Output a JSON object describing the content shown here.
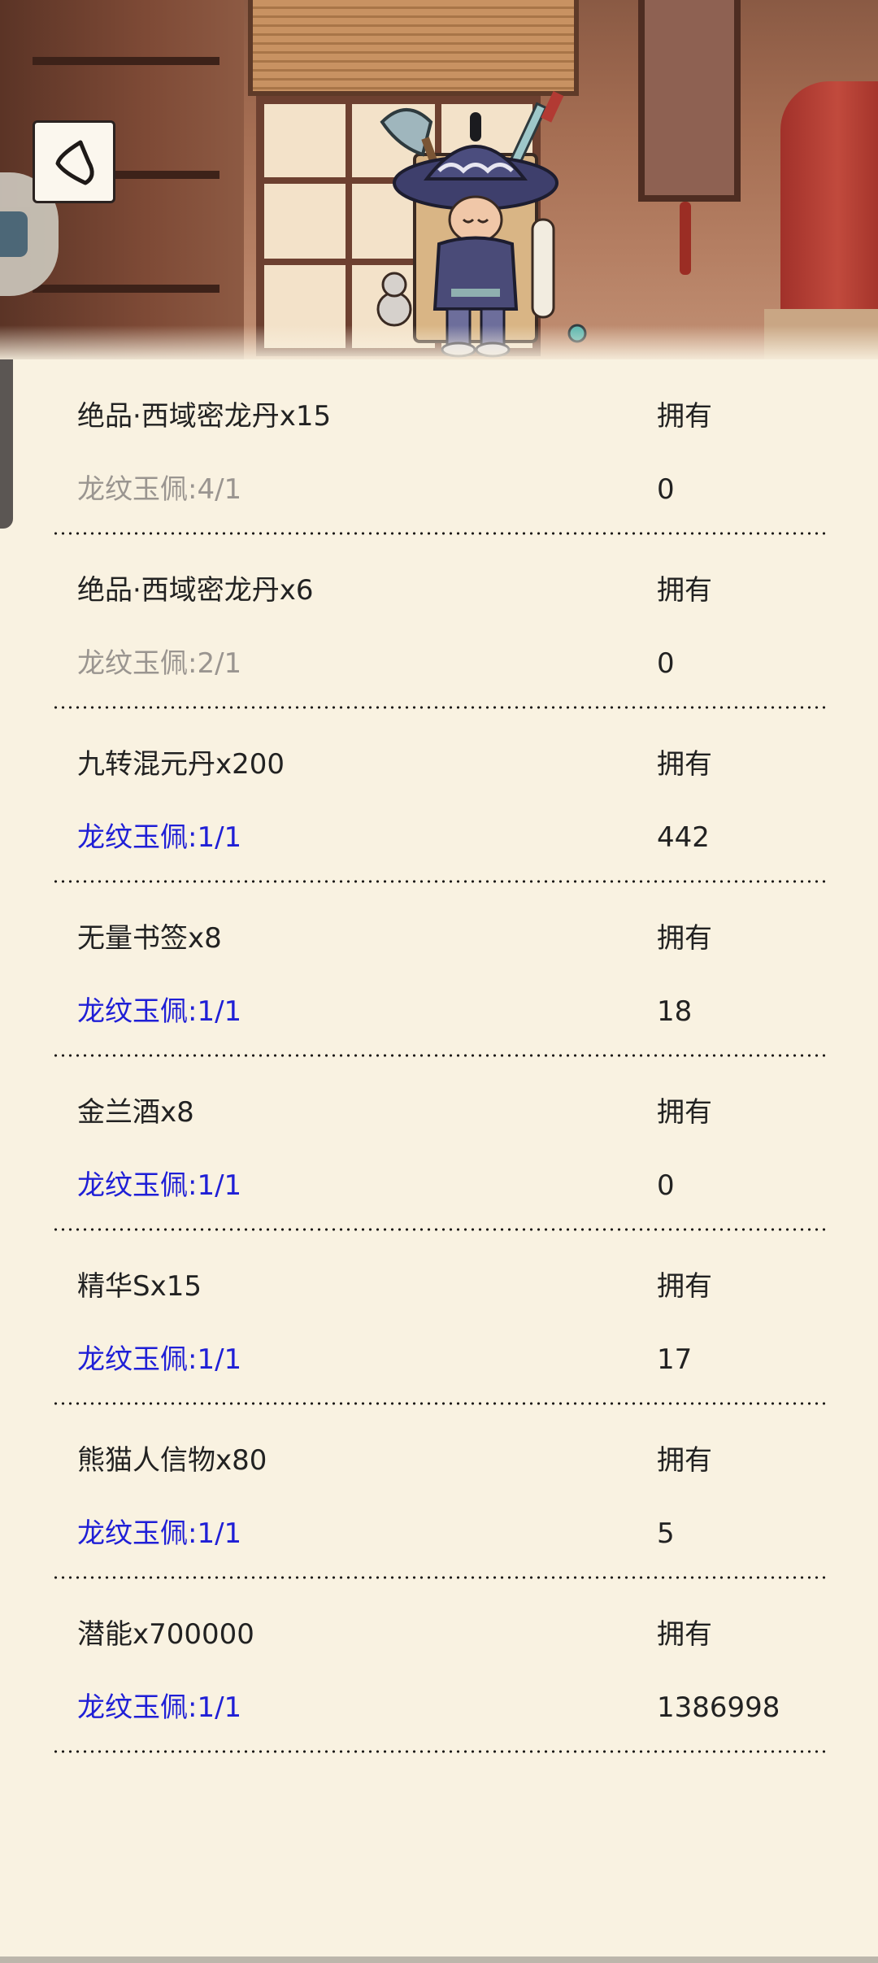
{
  "header": {
    "back_icon": "back-arrow-icon"
  },
  "exchange_items": [
    {
      "reward": "绝品·西域密龙丹x15",
      "own_label": "拥有",
      "requirement": "龙纹玉佩:4/1",
      "owned": "0",
      "status": "unmet"
    },
    {
      "reward": "绝品·西域密龙丹x6",
      "own_label": "拥有",
      "requirement": "龙纹玉佩:2/1",
      "owned": "0",
      "status": "unmet"
    },
    {
      "reward": "九转混元丹x200",
      "own_label": "拥有",
      "requirement": "龙纹玉佩:1/1",
      "owned": "442",
      "status": "met"
    },
    {
      "reward": "无量书签x8",
      "own_label": "拥有",
      "requirement": "龙纹玉佩:1/1",
      "owned": "18",
      "status": "met"
    },
    {
      "reward": "金兰酒x8",
      "own_label": "拥有",
      "requirement": "龙纹玉佩:1/1",
      "owned": "0",
      "status": "met"
    },
    {
      "reward": "精华Sx15",
      "own_label": "拥有",
      "requirement": "龙纹玉佩:1/1",
      "owned": "17",
      "status": "met"
    },
    {
      "reward": "熊猫人信物x80",
      "own_label": "拥有",
      "requirement": "龙纹玉佩:1/1",
      "owned": "5",
      "status": "met"
    },
    {
      "reward": "潜能x700000",
      "own_label": "拥有",
      "requirement": "龙纹玉佩:1/1",
      "owned": "1386998",
      "status": "met"
    }
  ],
  "colors": {
    "background": "#f9f2e1",
    "met_requirement": "#1f1fd6",
    "unmet_requirement": "#9a9590",
    "text": "#222222"
  }
}
